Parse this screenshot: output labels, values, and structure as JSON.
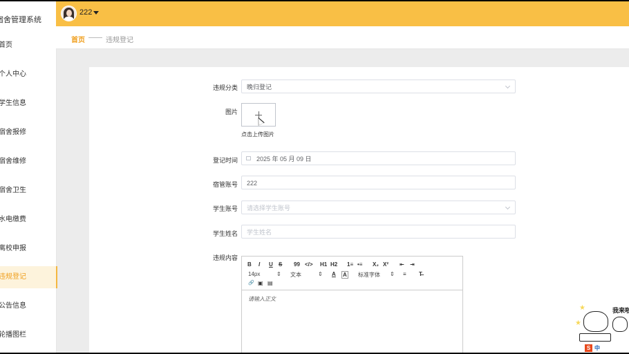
{
  "sidebar": {
    "title": "宿舍管理系统",
    "items": [
      {
        "label": "首页"
      },
      {
        "label": "个人中心"
      },
      {
        "label": "学生信息"
      },
      {
        "label": "宿舍报修"
      },
      {
        "label": "宿舍维修"
      },
      {
        "label": "宿舍卫生"
      },
      {
        "label": "水电缴费"
      },
      {
        "label": "离校申报"
      },
      {
        "label": "违规登记",
        "active": true
      },
      {
        "label": "公告信息"
      },
      {
        "label": "轮播图栏"
      }
    ]
  },
  "header": {
    "username": "222"
  },
  "breadcrumb": {
    "home": "首页",
    "separator": "——",
    "current": "违规登记"
  },
  "form": {
    "category": {
      "label": "违规分类",
      "value": "晚归登记"
    },
    "image": {
      "label": "图片",
      "hint": "点击上传图片"
    },
    "time": {
      "label": "登记时间",
      "value": "2025 年 05 月 09 日"
    },
    "dorm_account": {
      "label": "宿管账号",
      "value": "222"
    },
    "student_account": {
      "label": "学生账号",
      "placeholder": "请选择学生账号"
    },
    "student_name": {
      "label": "学生姓名",
      "placeholder": "学生姓名"
    },
    "content": {
      "label": "违规内容",
      "toolbar": {
        "bold": "B",
        "italic": "I",
        "underline": "U",
        "strike": "S",
        "quote": "99",
        "code": "</>",
        "h1": "H1",
        "h2": "H2",
        "ol": "1≡",
        "ul": "•≡",
        "sub": "X₂",
        "sup": "X²",
        "indent_dec": "⇤",
        "indent_inc": "⇥",
        "size": "14px",
        "heading": "文本",
        "color": "A",
        "bg": "A",
        "font": "标准字体",
        "align": "≡",
        "clear": "T̶",
        "link": "🔗",
        "image": "▣",
        "video": "▤"
      },
      "placeholder": "请输入正文"
    }
  },
  "mascot": {
    "caption": "我来啦",
    "ime_label": "中"
  },
  "colors": {
    "accent": "#f9bf45",
    "active_text": "#f0a020"
  }
}
